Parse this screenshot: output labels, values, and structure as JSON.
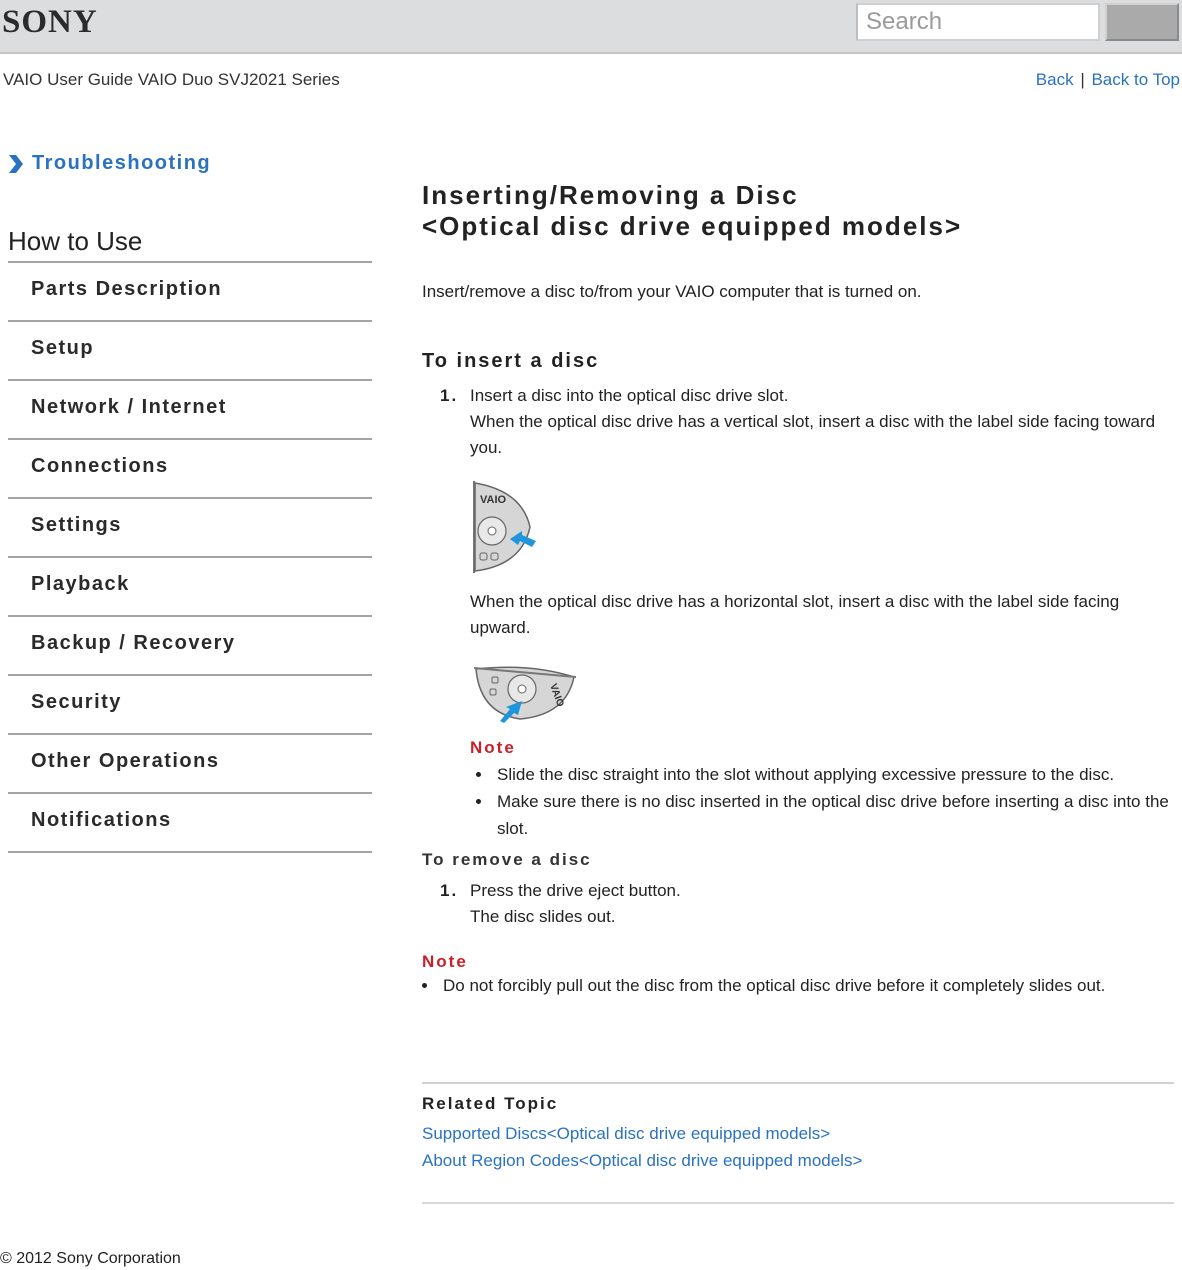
{
  "header": {
    "brand": "SONY",
    "search": {
      "placeholder": "Search",
      "value": ""
    },
    "guide_title": "VAIO User Guide VAIO Duo SVJ2021 Series",
    "links": {
      "back": "Back",
      "separator": "|",
      "back_to_top": "Back to Top"
    }
  },
  "sidebar": {
    "troubleshooting": "Troubleshooting",
    "section_title": "How to Use",
    "items": [
      {
        "label": "Parts Description"
      },
      {
        "label": "Setup"
      },
      {
        "label": "Network / Internet"
      },
      {
        "label": "Connections"
      },
      {
        "label": "Settings"
      },
      {
        "label": "Playback"
      },
      {
        "label": "Backup / Recovery"
      },
      {
        "label": "Security"
      },
      {
        "label": "Other Operations"
      },
      {
        "label": "Notifications"
      }
    ]
  },
  "main": {
    "title_line1": "Inserting/Removing a Disc",
    "title_line2": "<Optical disc drive equipped models>",
    "intro": "Insert/remove a disc to/from your VAIO computer that is turned on.",
    "insert": {
      "heading": "To insert a disc",
      "step_num": "1.",
      "step_text": "Insert a disc into the optical disc drive slot.",
      "vertical_text": "When the optical disc drive has a vertical slot, insert a disc with the label side facing toward you.",
      "horizontal_text": "When the optical disc drive has a horizontal slot, insert a disc with the label side facing upward.",
      "note_heading": "Note",
      "notes": [
        "Slide the disc straight into the slot without applying excessive pressure to the disc.",
        "Make sure there is no disc inserted in the optical disc drive before inserting a disc into the slot."
      ],
      "illustration_label": "VAIO"
    },
    "remove": {
      "heading": "To remove a disc",
      "step_num": "1.",
      "step_text": "Press the drive eject button.",
      "step_detail": "The disc slides out.",
      "note_heading": "Note",
      "notes": [
        "Do not forcibly pull out the disc from the optical disc drive before it completely slides out."
      ]
    },
    "related": {
      "heading": "Related Topic",
      "links": [
        "Supported Discs<Optical disc drive equipped models>",
        "About Region Codes<Optical disc drive equipped models>"
      ]
    }
  },
  "footer": {
    "copyright": "© 2012 Sony Corporation"
  },
  "colors": {
    "link": "#2a72c0",
    "note": "#c8202a",
    "accent_arrow": "#1e96dc"
  }
}
